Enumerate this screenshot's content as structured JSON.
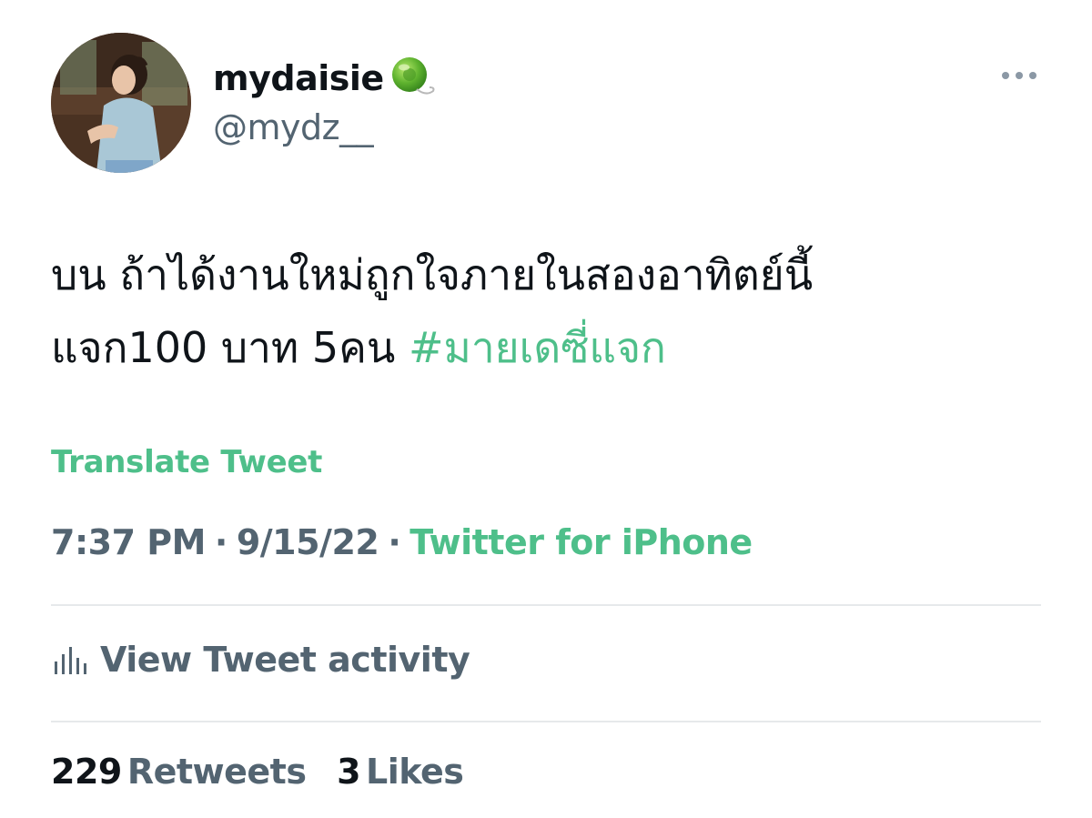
{
  "user": {
    "display_name": "mydaisie",
    "handle": "@mydz__",
    "badge_icon": "green-yoyo-emoji-icon"
  },
  "tweet": {
    "text_line_1": "บน ถ้าได้งานใหม่ถูกใจภายในสองอาทิตย์นี้",
    "text_line_2_plain": "แจก100 บาท 5คน ",
    "hashtag": "#มายเดซี่แจก",
    "translate_label": "Translate Tweet"
  },
  "meta": {
    "time": "7:37 PM",
    "separator_1": "·",
    "date": "9/15/22",
    "separator_2": "·",
    "source": "Twitter for iPhone"
  },
  "activity": {
    "label": "View Tweet activity",
    "icon": "bar-chart-icon"
  },
  "stats": {
    "retweets_count": "229",
    "retweets_label": "Retweets",
    "likes_count": "3",
    "likes_label": "Likes"
  },
  "colors": {
    "accent": "#4ebf8a",
    "primary_text": "#0f1419",
    "secondary_text": "#536471",
    "divider": "#e6e9eb"
  }
}
